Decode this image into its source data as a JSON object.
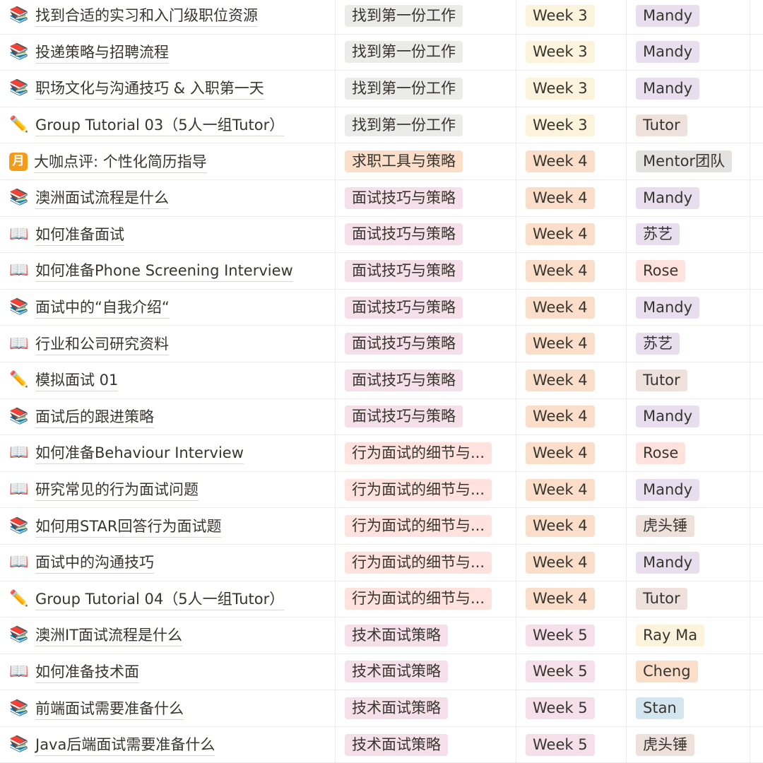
{
  "rows": [
    {
      "icon": "📚",
      "icon_name": "books-icon",
      "title": "找到合适的实习和入门级职位资源",
      "topic": "找到第一份工作",
      "topic_color": "grey",
      "week": "Week 3",
      "week_color": "w3",
      "owner": "Mandy",
      "owner_color": "purple"
    },
    {
      "icon": "📚",
      "icon_name": "books-icon",
      "title": "投递策略与招聘流程",
      "topic": "找到第一份工作",
      "topic_color": "grey",
      "week": "Week 3",
      "week_color": "w3",
      "owner": "Mandy",
      "owner_color": "purple"
    },
    {
      "icon": "📚",
      "icon_name": "books-icon",
      "title": " 职场文化与沟通技巧 & 入职第一天",
      "topic": "找到第一份工作",
      "topic_color": "grey",
      "week": "Week 3",
      "week_color": "w3",
      "owner": "Mandy",
      "owner_color": "purple"
    },
    {
      "icon": "✏️",
      "icon_name": "pencil-icon",
      "title": "Group Tutorial 03（5人一组Tutor）",
      "topic": "找到第一份工作",
      "topic_color": "grey",
      "week": "Week 3",
      "week_color": "w3",
      "owner": "Tutor",
      "owner_color": "brown"
    },
    {
      "icon": "月",
      "icon_name": "calendar-icon",
      "title": "大咖点评: 个性化简历指导",
      "topic": "求职工具与策略",
      "topic_color": "orange",
      "week": "Week 4",
      "week_color": "w4",
      "owner": "Mentor团队",
      "owner_color": "grey"
    },
    {
      "icon": "📚",
      "icon_name": "books-icon",
      "title": "澳洲面试流程是什么",
      "topic": "面试技巧与策略",
      "topic_color": "pink",
      "week": "Week 4",
      "week_color": "w4",
      "owner": "Mandy",
      "owner_color": "purple"
    },
    {
      "icon": "📖",
      "icon_name": "open-book-icon",
      "title": "如何准备面试",
      "topic": "面试技巧与策略",
      "topic_color": "pink",
      "week": "Week 4",
      "week_color": "w4",
      "owner": "苏艺",
      "owner_color": "purple"
    },
    {
      "icon": "📖",
      "icon_name": "open-book-icon",
      "title": "如何准备Phone Screening Interview",
      "topic": "面试技巧与策略",
      "topic_color": "pink",
      "week": "Week 4",
      "week_color": "w4",
      "owner": "Rose",
      "owner_color": "red"
    },
    {
      "icon": "📚",
      "icon_name": "books-icon",
      "title": "面试中的“自我介绍“",
      "topic": "面试技巧与策略",
      "topic_color": "pink",
      "week": "Week 4",
      "week_color": "w4",
      "owner": "Mandy",
      "owner_color": "purple"
    },
    {
      "icon": "📖",
      "icon_name": "open-book-icon",
      "title": "行业和公司研究资料",
      "topic": "面试技巧与策略",
      "topic_color": "pink",
      "week": "Week 4",
      "week_color": "w4",
      "owner": "苏艺",
      "owner_color": "purple"
    },
    {
      "icon": "✏️",
      "icon_name": "pencil-icon",
      "title": "模拟面试 01",
      "topic": "面试技巧与策略",
      "topic_color": "pink",
      "week": "Week 4",
      "week_color": "w4",
      "owner": "Tutor",
      "owner_color": "brown"
    },
    {
      "icon": "📚",
      "icon_name": "books-icon",
      "title": "面试后的跟进策略",
      "topic": "面试技巧与策略",
      "topic_color": "pink",
      "week": "Week 4",
      "week_color": "w4",
      "owner": "Mandy",
      "owner_color": "purple"
    },
    {
      "icon": "📖",
      "icon_name": "open-book-icon",
      "title": "如何准备Behaviour Interview",
      "topic": "行为面试的细节与...",
      "topic_color": "red",
      "week": "Week 4",
      "week_color": "w4",
      "owner": "Rose",
      "owner_color": "red"
    },
    {
      "icon": "📖",
      "icon_name": "open-book-icon",
      "title": "研究常见的行为面试问题",
      "topic": "行为面试的细节与...",
      "topic_color": "red",
      "week": "Week 4",
      "week_color": "w4",
      "owner": "Mandy",
      "owner_color": "purple"
    },
    {
      "icon": "📚",
      "icon_name": "books-icon",
      "title": "如何用STAR回答行为面试题",
      "topic": "行为面试的细节与...",
      "topic_color": "red",
      "week": "Week 4",
      "week_color": "w4",
      "owner": "虎头锤",
      "owner_color": "brown"
    },
    {
      "icon": "📖",
      "icon_name": "open-book-icon",
      "title": "面试中的沟通技巧",
      "topic": "行为面试的细节与...",
      "topic_color": "red",
      "week": "Week 4",
      "week_color": "w4",
      "owner": "Mandy",
      "owner_color": "purple"
    },
    {
      "icon": "✏️",
      "icon_name": "pencil-icon",
      "title": "Group Tutorial 04（5人一组Tutor）",
      "topic": "行为面试的细节与...",
      "topic_color": "red",
      "week": "Week 4",
      "week_color": "w4",
      "owner": "Tutor",
      "owner_color": "brown"
    },
    {
      "icon": "📚",
      "icon_name": "books-icon",
      "title": "澳洲IT面试流程是什么",
      "topic": "技术面试策略",
      "topic_color": "pink",
      "week": "Week 5",
      "week_color": "w5",
      "owner": "Ray Ma",
      "owner_color": "yellow"
    },
    {
      "icon": "📖",
      "icon_name": "open-book-icon",
      "title": "如何准备技术面",
      "topic": "技术面试策略",
      "topic_color": "pink",
      "week": "Week 5",
      "week_color": "w5",
      "owner": "Cheng",
      "owner_color": "orange"
    },
    {
      "icon": "📚",
      "icon_name": "books-icon",
      "title": "前端面试需要准备什么",
      "topic": "技术面试策略",
      "topic_color": "pink",
      "week": "Week 5",
      "week_color": "w5",
      "owner": "Stan",
      "owner_color": "blue"
    },
    {
      "icon": "📚",
      "icon_name": "books-icon",
      "title": "Java后端面试需要准备什么",
      "topic": "技术面试策略",
      "topic_color": "pink",
      "week": "Week 5",
      "week_color": "w5",
      "owner": "虎头锤",
      "owner_color": "brown"
    }
  ]
}
